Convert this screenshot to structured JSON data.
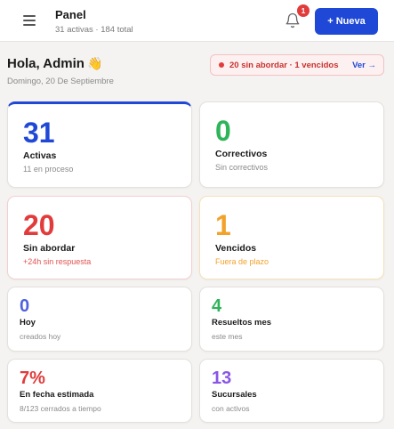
{
  "header": {
    "title": "Panel",
    "subtitle": "31 activas · 184 total",
    "notifications": "1",
    "new_button": "+ Nueva"
  },
  "greeting": {
    "text": "Hola, Admin",
    "emoji": "👋",
    "date": "Domingo, 20 De Septiembre"
  },
  "alert": {
    "text": "20 sin abordar · 1 vencidos",
    "link": "Ver →"
  },
  "cards": {
    "activas": {
      "value": "31",
      "title": "Activas",
      "sub": "11 en proceso"
    },
    "correctivos": {
      "value": "0",
      "title": "Correctivos",
      "sub": "Sin correctivos"
    },
    "sin_abordar": {
      "value": "20",
      "title": "Sin abordar",
      "sub": "+24h sin respuesta"
    },
    "vencidos": {
      "value": "1",
      "title": "Vencidos",
      "sub": "Fuera de plazo"
    },
    "hoy": {
      "value": "0",
      "title": "Hoy",
      "sub": "creados hoy"
    },
    "resueltos": {
      "value": "4",
      "title": "Resueltos mes",
      "sub": "este mes"
    },
    "fecha_estimada": {
      "value": "7%",
      "title": "En fecha estimada",
      "sub": "8/123 cerrados a tiempo"
    },
    "sucursales": {
      "value": "13",
      "title": "Sucursales",
      "sub": "con activos"
    }
  },
  "colors": {
    "primary": "#1f48d6",
    "green": "#2fb45a",
    "red": "#e23b3b",
    "amber": "#f1a22b",
    "indigo": "#4f5fe0",
    "purple": "#8a55e6"
  },
  "icons": {
    "menu": "hamburger-icon",
    "bell": "bell-icon"
  }
}
